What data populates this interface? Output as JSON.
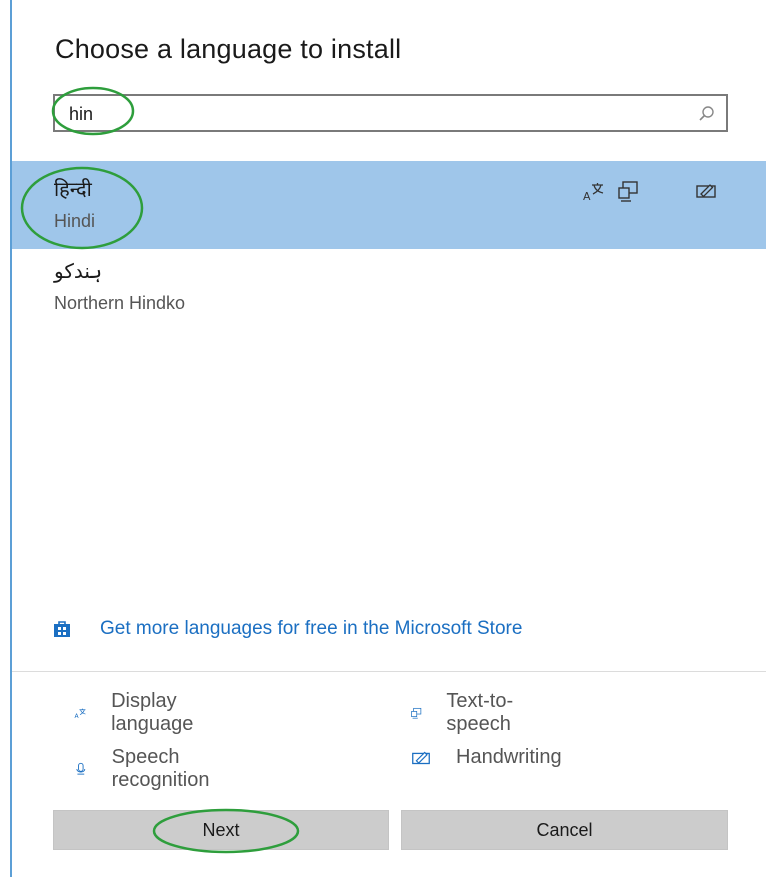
{
  "dialog": {
    "title": "Choose a language to install"
  },
  "search": {
    "value": "hin",
    "icon": "search-icon"
  },
  "languages": [
    {
      "native": "हिन्दी",
      "english": "Hindi",
      "selected": true,
      "features": [
        "display-language-icon",
        "text-to-speech-icon",
        "handwriting-icon"
      ]
    },
    {
      "native": "ہندکو",
      "english": "Northern Hindko",
      "selected": false,
      "features": []
    }
  ],
  "store_link": {
    "label": "Get more languages for free in the Microsoft Store",
    "icon": "store-icon"
  },
  "legend": [
    {
      "label": "Display language",
      "icon": "display-language-icon"
    },
    {
      "label": "Text-to-speech",
      "icon": "text-to-speech-icon"
    },
    {
      "label": "Speech recognition",
      "icon": "speech-recognition-icon"
    },
    {
      "label": "Handwriting",
      "icon": "handwriting-icon"
    }
  ],
  "buttons": {
    "next": "Next",
    "cancel": "Cancel"
  },
  "colors": {
    "selected_bg": "#9fc6ea",
    "link": "#1b6fc2",
    "annotation_circle": "#2e9e3c",
    "button_bg": "#cccccc"
  }
}
